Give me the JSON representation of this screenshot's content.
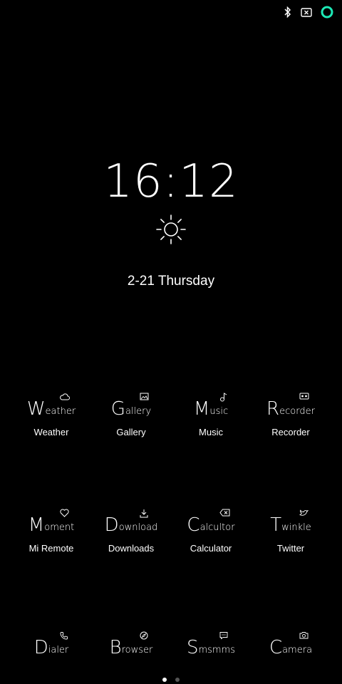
{
  "status_bar": {
    "icons": [
      "bluetooth-icon",
      "sim-card-none-icon",
      "battery-ring-icon"
    ],
    "accent_color": "#1de9b6"
  },
  "lockscreen": {
    "time": "16:12",
    "weather_icon": "sun-icon",
    "date": "2-21 Thursday"
  },
  "apps": [
    {
      "icon_text_big": "W",
      "icon_text_small": "eather",
      "icon": "cloud-icon",
      "label": "Weather"
    },
    {
      "icon_text_big": "G",
      "icon_text_small": "allery",
      "icon": "image-icon",
      "label": "Gallery"
    },
    {
      "icon_text_big": "M",
      "icon_text_small": "usic",
      "icon": "music-note-icon",
      "label": "Music"
    },
    {
      "icon_text_big": "R",
      "icon_text_small": "ecorder",
      "icon": "tape-icon",
      "label": "Recorder"
    },
    {
      "icon_text_big": "M",
      "icon_text_small": "oment",
      "icon": "heart-icon",
      "label": "Mi Remote"
    },
    {
      "icon_text_big": "D",
      "icon_text_small": "ownload",
      "icon": "download-icon",
      "label": "Downloads"
    },
    {
      "icon_text_big": "C",
      "icon_text_small": "alcultor",
      "icon": "backspace-icon",
      "label": "Calculator"
    },
    {
      "icon_text_big": "T",
      "icon_text_small": "winkle",
      "icon": "bird-icon",
      "label": "Twitter"
    },
    {
      "icon_text_big": "D",
      "icon_text_small": "ialer",
      "icon": "phone-icon",
      "label": ""
    },
    {
      "icon_text_big": "B",
      "icon_text_small": "rowser",
      "icon": "compass-icon",
      "label": ""
    },
    {
      "icon_text_big": "S",
      "icon_text_small": "msmms",
      "icon": "chat-icon",
      "label": ""
    },
    {
      "icon_text_big": "C",
      "icon_text_small": "amera",
      "icon": "camera-icon",
      "label": ""
    }
  ],
  "pager": {
    "pages": 2,
    "active": 0,
    "active_color": "#ffffff",
    "inactive_color": "#555555"
  }
}
